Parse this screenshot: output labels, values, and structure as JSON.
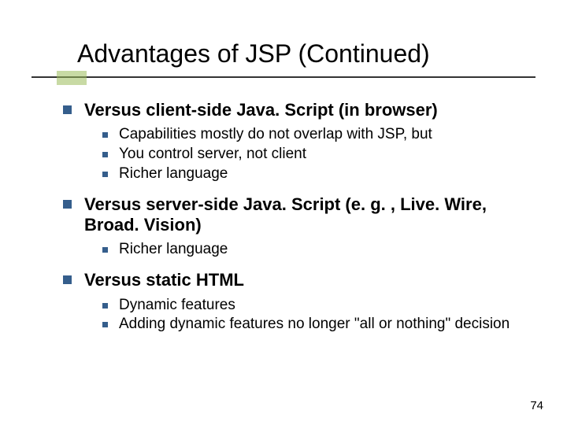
{
  "title": "Advantages of JSP (Continued)",
  "sections": [
    {
      "heading": "Versus client-side Java. Script (in browser)",
      "items": [
        "Capabilities mostly do not overlap with JSP, but",
        "You control server, not client",
        "Richer language"
      ]
    },
    {
      "heading": "Versus server-side Java. Script (e. g. , Live. Wire, Broad. Vision)",
      "items": [
        "Richer language"
      ]
    },
    {
      "heading": "Versus static HTML",
      "items": [
        "Dynamic features",
        "Adding dynamic features no longer \"all or nothing\" decision"
      ]
    }
  ],
  "page_number": "74"
}
